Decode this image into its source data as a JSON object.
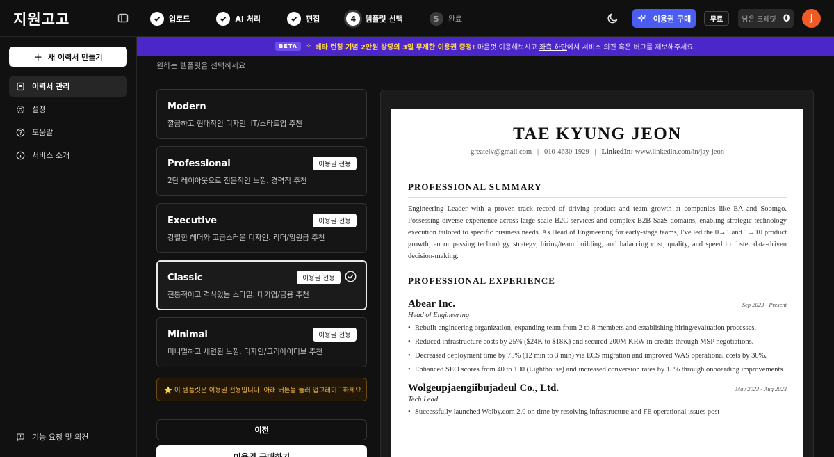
{
  "app": {
    "logo": "지원고고"
  },
  "steps": [
    {
      "num": "1",
      "label": "업로드",
      "state": "done"
    },
    {
      "num": "2",
      "label": "AI 처리",
      "state": "done"
    },
    {
      "num": "3",
      "label": "편집",
      "state": "done"
    },
    {
      "num": "4",
      "label": "템플릿 선택",
      "state": "current"
    },
    {
      "num": "5",
      "label": "완료",
      "state": "todo"
    }
  ],
  "header": {
    "buy_label": "이용권 구매",
    "free_label": "무료",
    "credits_label": "남은 크레딧",
    "credits_value": "0",
    "avatar_initial": "J"
  },
  "sidebar": {
    "new_resume": "새 이력서 만들기",
    "items": [
      {
        "label": "이력서 관리",
        "icon": "document-icon"
      },
      {
        "label": "설정",
        "icon": "gear-icon"
      },
      {
        "label": "도움말",
        "icon": "help-icon"
      },
      {
        "label": "서비스 소개",
        "icon": "info-icon"
      }
    ],
    "feedback": "기능 요청 및 의견"
  },
  "banner": {
    "badge": "BETA",
    "highlight": "베타 런칭 기념 2만원 상당의 3일 무제한 이용권 증정!",
    "text1": " 마음껏 이용해보시고 ",
    "link": "좌측 하단",
    "text2": "에서 서비스 의견 혹은 버그를 제보해주세요."
  },
  "main": {
    "instruction": "원하는 템플릿을 선택하세요",
    "premium_tag": "이용권 전용",
    "templates": [
      {
        "name": "Modern",
        "desc": "깔끔하고 현대적인 디자인. IT/스타트업 추천",
        "premium": false,
        "selected": false
      },
      {
        "name": "Professional",
        "desc": "2단 레이아웃으로 전문적인 느낌. 경력직 추천",
        "premium": true,
        "selected": false
      },
      {
        "name": "Executive",
        "desc": "강렬한 헤더와 고급스러운 디자인. 리더/임원급 추천",
        "premium": true,
        "selected": false
      },
      {
        "name": "Classic",
        "desc": "전통적이고 격식있는 스타일. 대기업/금융 추천",
        "premium": true,
        "selected": true
      },
      {
        "name": "Minimal",
        "desc": "미니멀하고 세련된 느낌. 디자인/크리에이티브 추천",
        "premium": true,
        "selected": false
      }
    ],
    "notice": "⭐ 이 템플릿은 이용권 전용입니다. 아래 버튼을 눌러 업그레이드하세요.",
    "prev_button": "이전",
    "purchase_button": "이용권 구매하기"
  },
  "resume": {
    "name": "TAE KYUNG JEON",
    "email": "greatelv@gmail.com",
    "phone": "010-4630-1929",
    "linkedin_label": "LinkedIn:",
    "linkedin": "www.linkedin.com/in/jay-jeon",
    "sep": "|",
    "summary_heading": "PROFESSIONAL SUMMARY",
    "summary": "Engineering Leader with a proven track record of driving product and team growth at companies like EA and Soomgo. Possessing diverse experience across large-scale B2C services and complex B2B SaaS domains, enabling strategic technology execution tailored to specific business needs. As Head of Engineering for early-stage teams, I've led the 0→1 and 1→10 product growth, encompassing technology strategy, hiring/team building, and balancing cost, quality, and speed to foster data-driven decision-making.",
    "experience_heading": "PROFESSIONAL EXPERIENCE",
    "jobs": [
      {
        "company": "Abear Inc.",
        "date": "Sep 2023 - Present",
        "role": "Head of Engineering",
        "bullets": [
          "Rebuilt engineering organization, expanding team from 2 to 8 members and establishing hiring/evaluation processes.",
          "Reduced infrastructure costs by 25% ($24K to $18K) and secured 200M KRW in credits through MSP negotiations.",
          "Decreased deployment time by 75% (12 min to 3 min) via ECS migration and improved WAS operational costs by 30%.",
          "Enhanced SEO scores from 40 to 100 (Lighthouse) and increased conversion rates by 15% through onboarding improvements."
        ]
      },
      {
        "company": "Wolgeupjaengiibujadeul Co., Ltd.",
        "date": "May 2023 - Aug 2023",
        "role": "Tech Lead",
        "bullets": [
          "Successfully launched Wolby.com 2.0 on time by resolving infrastructure and FE operational issues post"
        ]
      }
    ]
  },
  "colors": {
    "accent": "#4b5cf0",
    "banner": "#4b26c9",
    "avatar": "#f05a24",
    "notice": "#f2b84b"
  }
}
